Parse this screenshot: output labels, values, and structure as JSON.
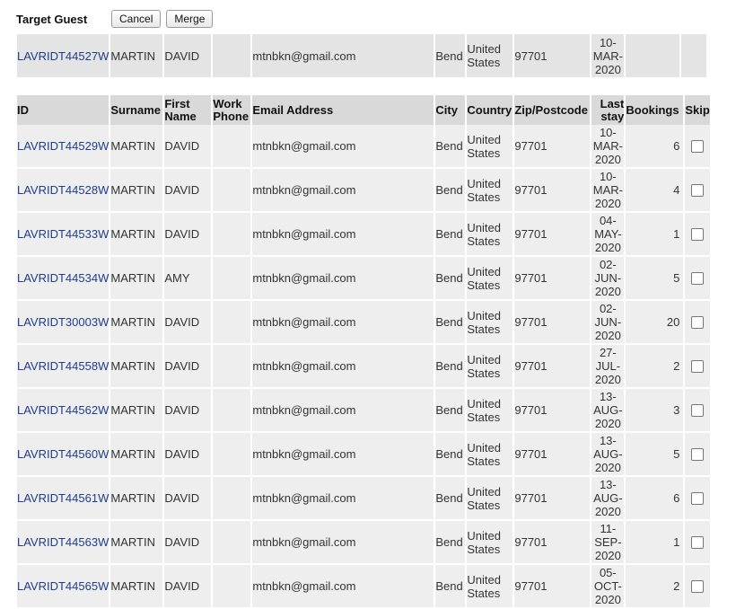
{
  "target_section": {
    "label": "Target Guest",
    "cancel_label": "Cancel",
    "merge_label": "Merge",
    "row": {
      "id": "LAVRIDT44527W",
      "surname": "MARTIN",
      "first_name": "DAVID",
      "work_phone": "",
      "email": "mtnbkn@gmail.com",
      "city": "Bend",
      "country_1": "United",
      "country_2": "States",
      "zip": "97701",
      "stay_1": "10-",
      "stay_2": "MAR-",
      "stay_3": "2020"
    }
  },
  "table": {
    "headers": {
      "id": "ID",
      "surname": "Surname",
      "first_1": "First",
      "first_2": "Name",
      "work_1": "Work",
      "work_2": "Phone",
      "email": "Email Address",
      "city": "City",
      "country": "Country",
      "zip": "Zip/Postcode",
      "stay_1": "Last",
      "stay_2": "stay",
      "bookings": "Bookings",
      "skip": "Skip"
    },
    "rows": [
      {
        "id": "LAVRIDT44529W",
        "surname": "MARTIN",
        "first_name": "DAVID",
        "work_phone": "",
        "email": "mtnbkn@gmail.com",
        "city": "Bend",
        "country_1": "United",
        "country_2": "States",
        "zip": "97701",
        "stay_1": "10-",
        "stay_2": "MAR-",
        "stay_3": "2020",
        "bookings": "6"
      },
      {
        "id": "LAVRIDT44528W",
        "surname": "MARTIN",
        "first_name": "DAVID",
        "work_phone": "",
        "email": "mtnbkn@gmail.com",
        "city": "Bend",
        "country_1": "United",
        "country_2": "States",
        "zip": "97701",
        "stay_1": "10-",
        "stay_2": "MAR-",
        "stay_3": "2020",
        "bookings": "4"
      },
      {
        "id": "LAVRIDT44533W",
        "surname": "MARTIN",
        "first_name": "DAVID",
        "work_phone": "",
        "email": "mtnbkn@gmail.com",
        "city": "Bend",
        "country_1": "United",
        "country_2": "States",
        "zip": "97701",
        "stay_1": "04-",
        "stay_2": "MAY-",
        "stay_3": "2020",
        "bookings": "1"
      },
      {
        "id": "LAVRIDT44534W",
        "surname": "MARTIN",
        "first_name": "AMY",
        "work_phone": "",
        "email": "mtnbkn@gmail.com",
        "city": "Bend",
        "country_1": "United",
        "country_2": "States",
        "zip": "97701",
        "stay_1": "02-",
        "stay_2": "JUN-",
        "stay_3": "2020",
        "bookings": "5"
      },
      {
        "id": "LAVRIDT30003W",
        "surname": "MARTIN",
        "first_name": "DAVID",
        "work_phone": "",
        "email": "mtnbkn@gmail.com",
        "city": "Bend",
        "country_1": "United",
        "country_2": "States",
        "zip": "97701",
        "stay_1": "02-",
        "stay_2": "JUN-",
        "stay_3": "2020",
        "bookings": "20"
      },
      {
        "id": "LAVRIDT44558W",
        "surname": "MARTIN",
        "first_name": "DAVID",
        "work_phone": "",
        "email": "mtnbkn@gmail.com",
        "city": "Bend",
        "country_1": "United",
        "country_2": "States",
        "zip": "97701",
        "stay_1": "27-",
        "stay_2": "JUL-",
        "stay_3": "2020",
        "bookings": "2"
      },
      {
        "id": "LAVRIDT44562W",
        "surname": "MARTIN",
        "first_name": "DAVID",
        "work_phone": "",
        "email": "mtnbkn@gmail.com",
        "city": "Bend",
        "country_1": "United",
        "country_2": "States",
        "zip": "97701",
        "stay_1": "13-",
        "stay_2": "AUG-",
        "stay_3": "2020",
        "bookings": "3"
      },
      {
        "id": "LAVRIDT44560W",
        "surname": "MARTIN",
        "first_name": "DAVID",
        "work_phone": "",
        "email": "mtnbkn@gmail.com",
        "city": "Bend",
        "country_1": "United",
        "country_2": "States",
        "zip": "97701",
        "stay_1": "13-",
        "stay_2": "AUG-",
        "stay_3": "2020",
        "bookings": "5"
      },
      {
        "id": "LAVRIDT44561W",
        "surname": "MARTIN",
        "first_name": "DAVID",
        "work_phone": "",
        "email": "mtnbkn@gmail.com",
        "city": "Bend",
        "country_1": "United",
        "country_2": "States",
        "zip": "97701",
        "stay_1": "13-",
        "stay_2": "AUG-",
        "stay_3": "2020",
        "bookings": "6"
      },
      {
        "id": "LAVRIDT44563W",
        "surname": "MARTIN",
        "first_name": "DAVID",
        "work_phone": "",
        "email": "mtnbkn@gmail.com",
        "city": "Bend",
        "country_1": "United",
        "country_2": "States",
        "zip": "97701",
        "stay_1": "11-",
        "stay_2": "SEP-",
        "stay_3": "2020",
        "bookings": "1"
      },
      {
        "id": "LAVRIDT44565W",
        "surname": "MARTIN",
        "first_name": "DAVID",
        "work_phone": "",
        "email": "mtnbkn@gmail.com",
        "city": "Bend",
        "country_1": "United",
        "country_2": "States",
        "zip": "97701",
        "stay_1": "05-",
        "stay_2": "OCT-",
        "stay_3": "2020",
        "bookings": "2"
      }
    ]
  }
}
